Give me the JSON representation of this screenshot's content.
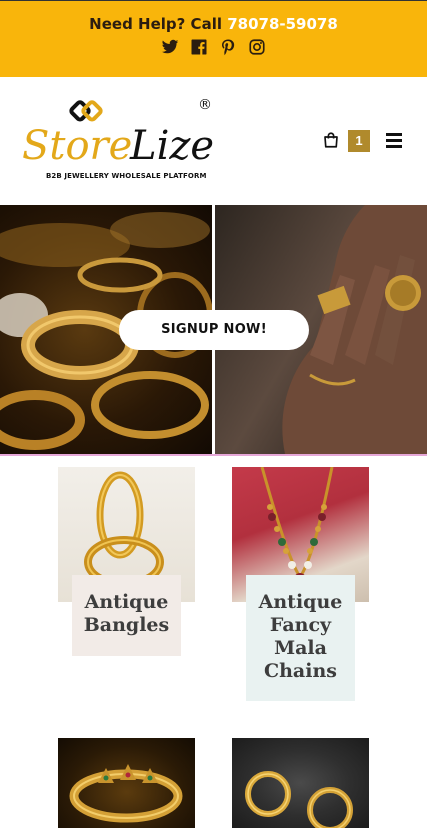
{
  "topbar": {
    "help_text": "Need Help? Call ",
    "phone": "78078-59078",
    "socials": [
      "twitter-icon",
      "facebook-icon",
      "pinterest-icon",
      "instagram-icon"
    ]
  },
  "header": {
    "logo_text": "StoreLize",
    "logo_registered": "®",
    "logo_tagline": "B2B JEWELLERY WHOLESALE PLATFORM",
    "cart_count": "1"
  },
  "hero": {
    "cta_label": "SIGNUP NOW!"
  },
  "categories": [
    {
      "label": "Antique Bangles"
    },
    {
      "label": "Antique Fancy Mala Chains"
    },
    {
      "label": ""
    },
    {
      "label": ""
    }
  ],
  "colors": {
    "topbar_bg": "#f9b50b",
    "brand_gold": "#e3a81a",
    "cart_badge": "#b08a2c",
    "hero_divider": "#e6a7d8"
  }
}
